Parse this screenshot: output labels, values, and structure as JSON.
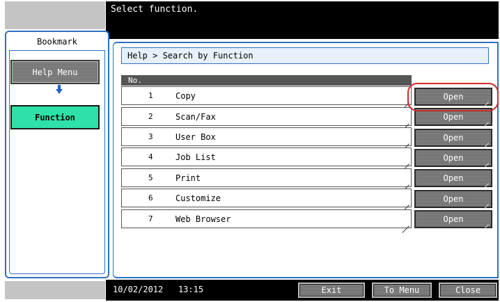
{
  "header": {
    "title": "Select function."
  },
  "sidebar": {
    "label": "Bookmark",
    "items": [
      {
        "label": "Help Menu"
      },
      {
        "label": "Function"
      }
    ]
  },
  "main": {
    "breadcrumb": "Help > Search by Function",
    "column_header": "No.",
    "rows": [
      {
        "num": "1",
        "name": "Copy",
        "action": "Open"
      },
      {
        "num": "2",
        "name": "Scan/Fax",
        "action": "Open"
      },
      {
        "num": "3",
        "name": "User Box",
        "action": "Open"
      },
      {
        "num": "4",
        "name": "Job List",
        "action": "Open"
      },
      {
        "num": "5",
        "name": "Print",
        "action": "Open"
      },
      {
        "num": "6",
        "name": "Customize",
        "action": "Open"
      },
      {
        "num": "7",
        "name": "Web Browser",
        "action": "Open"
      }
    ]
  },
  "footer": {
    "date": "10/02/2012",
    "time": "13:15",
    "exit_label": "Exit",
    "menu_label": "To Menu",
    "close_label": "Close"
  },
  "colors": {
    "accent": "#2e6fc4",
    "active": "#2fe0a8",
    "highlight": "#d12a2a"
  }
}
